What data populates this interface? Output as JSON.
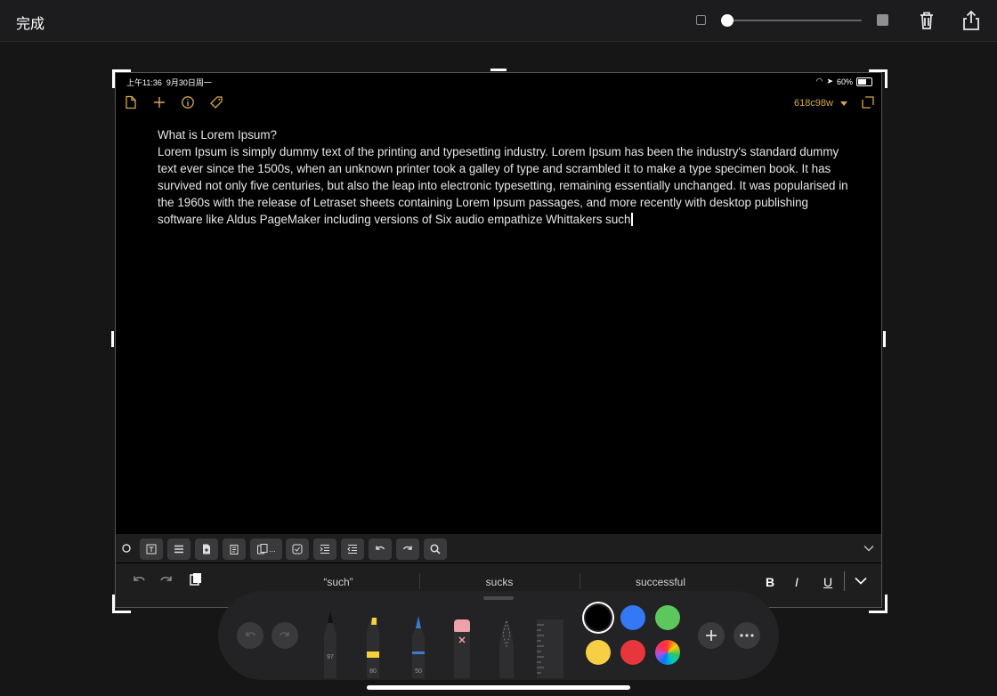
{
  "topbar": {
    "done_label": "完成",
    "size_slider_value": 0.0
  },
  "device": {
    "time": "上午11:36",
    "date": "9月30日周一",
    "battery": "60%"
  },
  "app": {
    "branch": "618c98w"
  },
  "document": {
    "title": "What is Lorem Ipsum?",
    "body": "Lorem Ipsum is simply dummy text of the printing and typesetting industry. Lorem Ipsum has been the industry's standard dummy text ever since the 1500s, when an unknown printer took a galley of type and scrambled it to make a type specimen book. It has survived not only five centuries, but also the leap into electronic typesetting, remaining essentially unchanged. It was popularised in the 1960s with the release of Letraset sheets containing Lorem Ipsum passages, and more recently with desktop publishing software like Aldus PageMaker including versions of Six audio empathize Whittakers such"
  },
  "format_toolbar": {
    "buttons": [
      "text-box-icon",
      "list-icon",
      "insert-file-icon",
      "clipboard-icon",
      "copy-more-icon",
      "checkbox-icon",
      "indent-icon",
      "outdent-icon",
      "undo-icon",
      "redo-icon",
      "search-icon"
    ],
    "ellipsis": "..."
  },
  "suggestions": {
    "items": [
      "“such”",
      "sucks",
      "successful"
    ],
    "bold": "B",
    "italic": "I",
    "underline": "U"
  },
  "palette": {
    "tools": [
      {
        "name": "pen",
        "width": "97"
      },
      {
        "name": "highlighter",
        "width": "80",
        "color": "#f5d13c"
      },
      {
        "name": "pencil",
        "width": "50",
        "color": "#3a7bd5"
      },
      {
        "name": "eraser"
      },
      {
        "name": "lasso"
      },
      {
        "name": "ruler"
      }
    ],
    "colors": [
      "#000000",
      "#3478f6",
      "#5cc75c",
      "#f6cf45",
      "#e8373c",
      "spectrum"
    ]
  }
}
